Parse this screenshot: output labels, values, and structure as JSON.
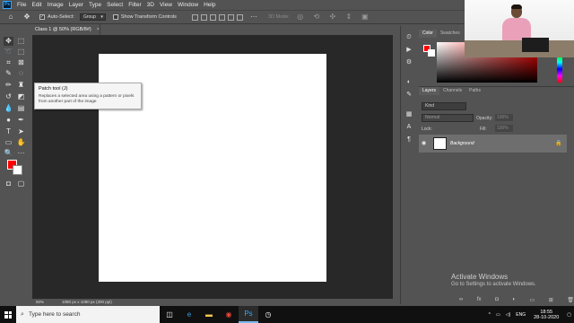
{
  "app": {
    "logo": "Ps"
  },
  "menu": [
    "File",
    "Edit",
    "Image",
    "Layer",
    "Type",
    "Select",
    "Filter",
    "3D",
    "View",
    "Window",
    "Help"
  ],
  "options": {
    "auto_select_label": "Auto-Select:",
    "auto_select_value": "Group",
    "show_transform_label": "Show Transform Controls",
    "mode_3d_label": "3D Mode:"
  },
  "document": {
    "tab_title": "Class 1 @ 50% (RGB/8#)",
    "close_symbol": "×",
    "zoom": "50%",
    "info": "1080 px x 1080 px (300 ppi)"
  },
  "tooltip": {
    "title": "Patch tool (J)",
    "description": "Replaces a selected area using a pattern or pixels from another part of the image"
  },
  "color_panel": {
    "tabs": [
      "Color",
      "Swatches"
    ],
    "foreground": "#ff0000",
    "background": "#ffffff"
  },
  "layers_panel": {
    "tabs": [
      "Layers",
      "Channels",
      "Paths"
    ],
    "kind_label": "Kind",
    "blend_mode": "Normal",
    "opacity_label": "Opacity:",
    "opacity_value": "100%",
    "lock_label": "Lock:",
    "fill_label": "Fill:",
    "fill_value": "100%",
    "layers": [
      {
        "name": "Background",
        "visible": true,
        "locked": true
      }
    ]
  },
  "watermark": {
    "title": "Activate Windows",
    "subtitle": "Go to Settings to activate Windows."
  },
  "taskbar": {
    "search_placeholder": "Type here to search",
    "language": "ENG",
    "time": "18:55",
    "date": "28-10-2020"
  },
  "icons": {
    "move": "move-icon",
    "marquee": "marquee-icon",
    "lasso": "lasso-icon",
    "crop": "crop-icon",
    "eyedropper": "eyedropper-icon",
    "brush": "brush-icon",
    "stamp": "stamp-icon",
    "eraser": "eraser-icon",
    "gradient": "gradient-icon",
    "blur": "blur-icon",
    "dodge": "dodge-icon",
    "pen": "pen-icon",
    "type": "type-icon",
    "path-select": "path-select-icon",
    "shape": "shape-icon",
    "hand": "hand-icon",
    "zoom": "zoom-icon"
  }
}
